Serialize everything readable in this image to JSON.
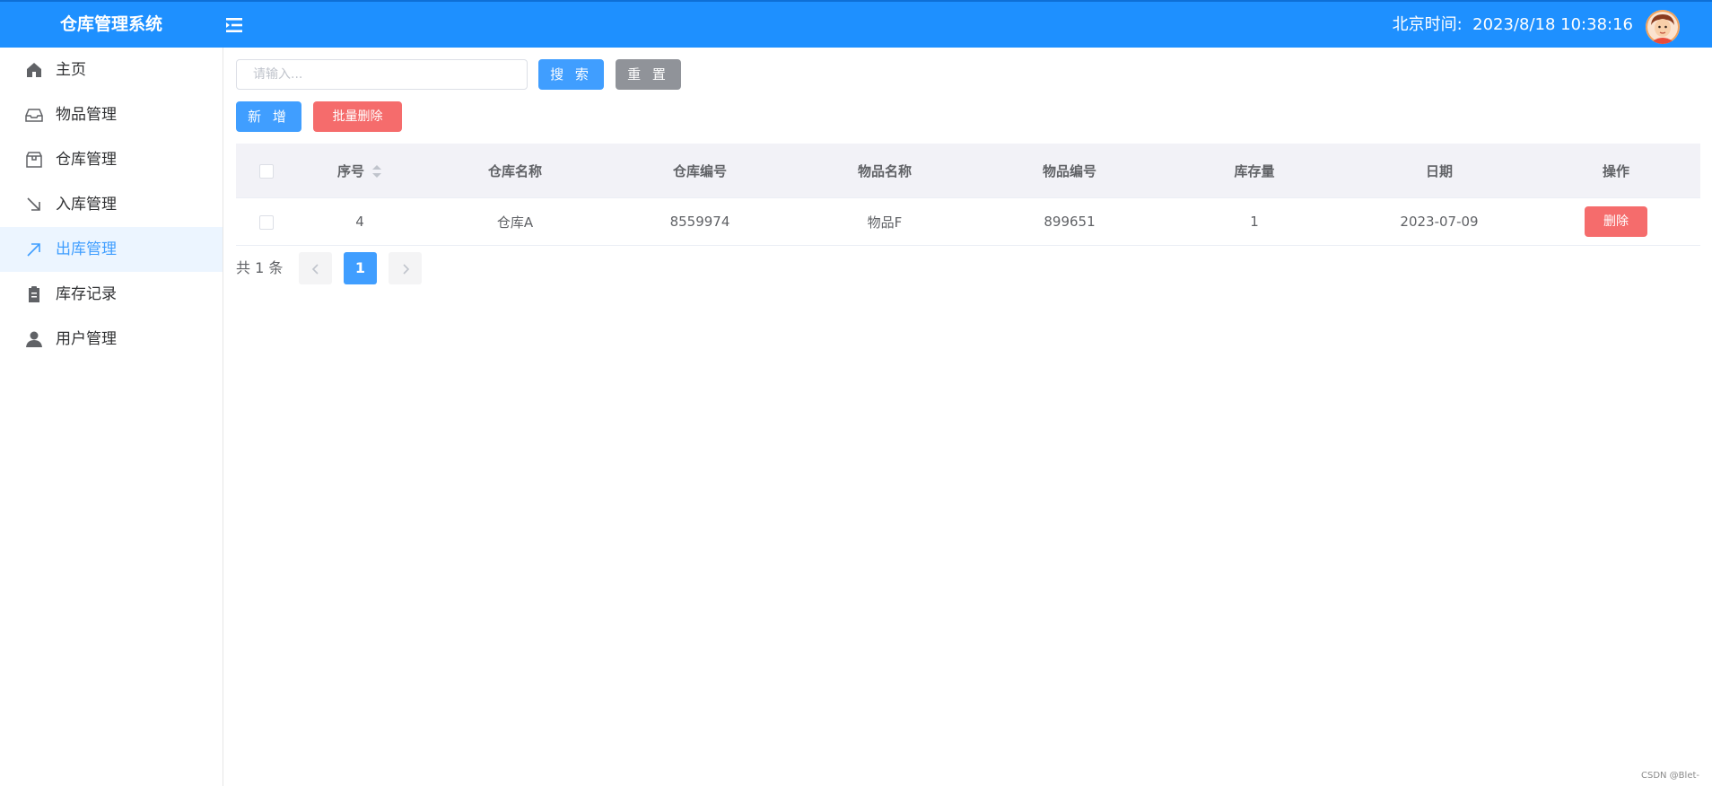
{
  "header": {
    "app_title": "仓库管理系统",
    "clock_label": "北京时间:",
    "clock_value": "2023/8/18 10:38:16"
  },
  "sidebar": {
    "items": [
      {
        "label": "主页",
        "icon": "home-icon"
      },
      {
        "label": "物品管理",
        "icon": "inbox-icon"
      },
      {
        "label": "仓库管理",
        "icon": "box-icon"
      },
      {
        "label": "入库管理",
        "icon": "arrow-bottom-right-icon"
      },
      {
        "label": "出库管理",
        "icon": "arrow-top-right-icon",
        "active": true
      },
      {
        "label": "库存记录",
        "icon": "clipboard-icon"
      },
      {
        "label": "用户管理",
        "icon": "user-icon"
      }
    ]
  },
  "search": {
    "placeholder": "请输入...",
    "value": "",
    "search_label": "搜 索",
    "reset_label": "重 置"
  },
  "actions": {
    "add_label": "新 增",
    "batch_delete_label": "批量删除"
  },
  "table": {
    "columns": [
      "序号",
      "仓库名称",
      "仓库编号",
      "物品名称",
      "物品编号",
      "库存量",
      "日期",
      "操作"
    ],
    "rows": [
      {
        "id": "4",
        "warehouse_name": "仓库A",
        "warehouse_no": "8559974",
        "item_name": "物品F",
        "item_no": "899651",
        "stock": "1",
        "date": "2023-07-09",
        "delete_label": "删除"
      }
    ]
  },
  "pagination": {
    "total_label": "共 1 条",
    "current_page": "1",
    "prev_icon": "chevron-left-icon",
    "next_icon": "chevron-right-icon"
  },
  "colors": {
    "header": "#1e90ff",
    "primary": "#409eff",
    "danger": "#f56c6c",
    "gray": "#909399",
    "active_bg": "#ecf5ff"
  },
  "watermark": "CSDN @Blet-"
}
